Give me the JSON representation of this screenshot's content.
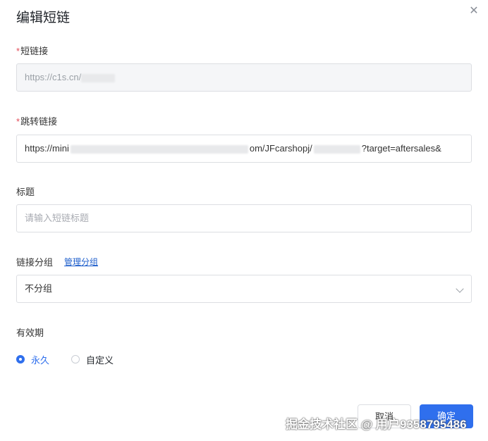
{
  "dialog": {
    "title": "编辑短链",
    "close_icon": "close-icon"
  },
  "short_link": {
    "required_mark": "*",
    "label": "短链接",
    "value": "https://c1s.cn/"
  },
  "redirect_link": {
    "required_mark": "*",
    "label": "跳转链接",
    "value_start": "https://mini",
    "value_mid": "om/JFcarshopj/",
    "value_end": "?target=aftersales&"
  },
  "title_field": {
    "label": "标题",
    "placeholder": "请输入短链标题"
  },
  "group": {
    "label": "链接分组",
    "manage_link": "管理分组",
    "selected": "不分组"
  },
  "validity": {
    "label": "有效期",
    "options": [
      {
        "label": "永久",
        "checked": true
      },
      {
        "label": "自定义",
        "checked": false
      }
    ]
  },
  "buttons": {
    "cancel": "取消",
    "ok": "确定"
  },
  "watermark": "掘金技术社区 @ 用户9358795486",
  "colors": {
    "primary": "#2f6fed",
    "required": "#e34d59",
    "link": "#1f5fcc"
  }
}
